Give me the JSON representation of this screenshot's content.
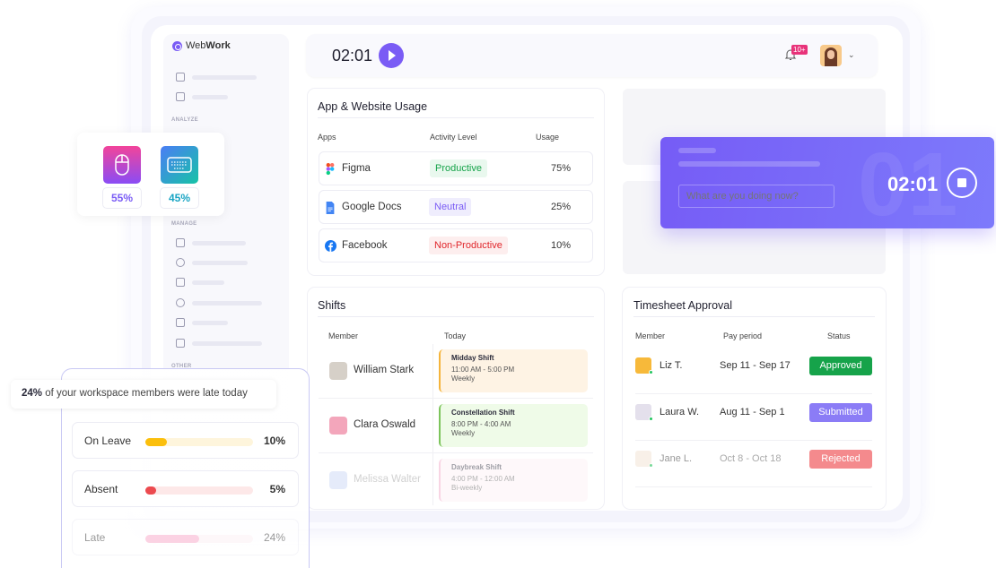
{
  "brand": {
    "name_light": "Web",
    "name_bold": "Work"
  },
  "sidebar": {
    "sections": [
      "ANALYZE",
      "MANAGE",
      "OTHER"
    ]
  },
  "topbar": {
    "timer": "02:01",
    "notifications_badge": "10+"
  },
  "app_usage": {
    "title": "App & Website Usage",
    "columns": [
      "Apps",
      "Activity Level",
      "Usage"
    ],
    "rows": [
      {
        "app": "Figma",
        "icon": "figma-icon",
        "level": "Productive",
        "usage": "75%",
        "level_color": "#16a34a",
        "level_bg": "#e9f8ee"
      },
      {
        "app": "Google Docs",
        "icon": "google-docs-icon",
        "level": "Neutral",
        "usage": "25%",
        "level_color": "#7a5cf5",
        "level_bg": "#efedfd"
      },
      {
        "app": "Facebook",
        "icon": "facebook-icon",
        "level": "Non-Productive",
        "usage": "10%",
        "level_color": "#e0262b",
        "level_bg": "#fdeeee"
      }
    ]
  },
  "floating_timer": {
    "placeholder": "What are you doing now?",
    "time": "02:01",
    "bg_digits": "01"
  },
  "shifts": {
    "title": "Shifts",
    "columns": [
      "Member",
      "Today"
    ],
    "rows": [
      {
        "member": "William Stark",
        "shift": "Midday Shift",
        "time": "11:00 AM - 5:00 PM",
        "freq": "Weekly",
        "accent": "#f5b43c",
        "bg": "#fef3e4"
      },
      {
        "member": "Clara Oswald",
        "shift": "Constellation Shift",
        "time": "8:00 PM - 4:00 AM",
        "freq": "Weekly",
        "accent": "#7cc45b",
        "bg": "#effbe8"
      },
      {
        "member": "Melissa Walter",
        "shift": "Daybreak Shift",
        "time": "4:00 PM - 12:00 AM",
        "freq": "Bi-weekly",
        "accent": "#f1a4c4",
        "bg": "#fdf1f5"
      }
    ]
  },
  "timesheet": {
    "title": "Timesheet Approval",
    "columns": [
      "Member",
      "Pay period",
      "Status"
    ],
    "rows": [
      {
        "member": "Liz T.",
        "period": "Sep 11 - Sep 17",
        "status": "Approved",
        "status_color": "#16a34a"
      },
      {
        "member": "Laura W.",
        "period": "Aug 11 - Sep 1",
        "status": "Submitted",
        "status_color": "#8b7cf6"
      },
      {
        "member": "Jane L.",
        "period": "Oct 8 - Oct 18",
        "status": "Rejected",
        "status_color": "#f26d71"
      }
    ]
  },
  "input_widget": {
    "mouse_pct": "55%",
    "keyboard_pct": "45%"
  },
  "attendance": {
    "tooltip_pct": "24%",
    "tooltip_text": " of your workspace members were late today",
    "rows": [
      {
        "label": "On Leave",
        "value": "10%",
        "fraction": 0.2,
        "color": "#fbbf0c",
        "track": "#fef5dc"
      },
      {
        "label": "Absent",
        "value": "5%",
        "fraction": 0.1,
        "color": "#ec4a4f",
        "track": "#fde8e8"
      },
      {
        "label": "Late",
        "value": "24%",
        "fraction": 0.5,
        "color": "#f9a8c9",
        "track": "#fdf1f5"
      }
    ]
  }
}
